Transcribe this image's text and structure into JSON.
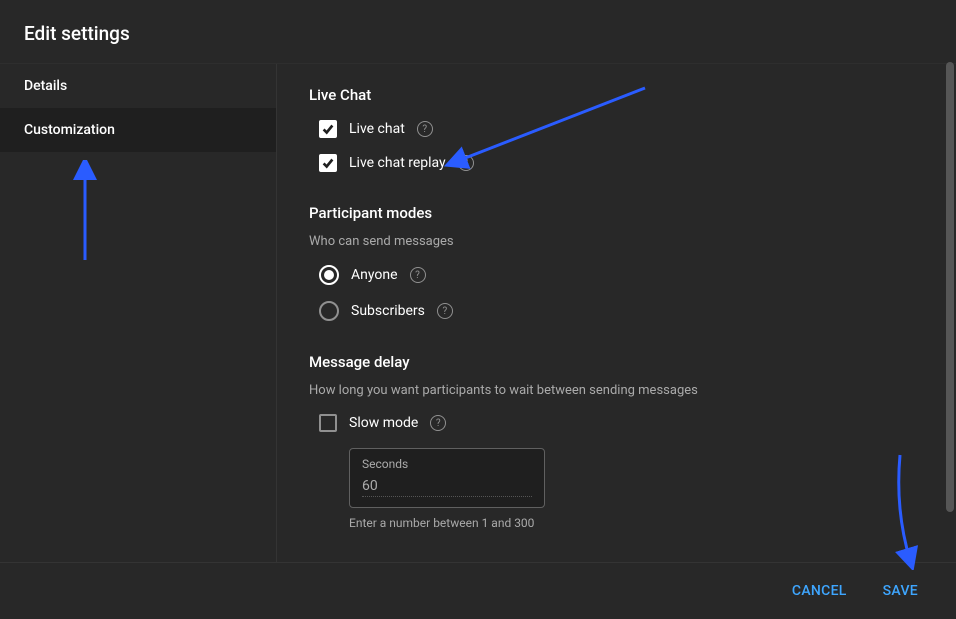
{
  "dialog": {
    "title": "Edit settings"
  },
  "sidebar": {
    "items": [
      {
        "label": "Details"
      },
      {
        "label": "Customization"
      }
    ]
  },
  "sections": {
    "liveChat": {
      "title": "Live Chat",
      "opts": [
        {
          "label": "Live chat"
        },
        {
          "label": "Live chat replay"
        }
      ]
    },
    "participantModes": {
      "title": "Participant modes",
      "sub": "Who can send messages",
      "opts": [
        {
          "label": "Anyone"
        },
        {
          "label": "Subscribers"
        }
      ]
    },
    "messageDelay": {
      "title": "Message delay",
      "sub": "How long you want participants to wait between sending messages",
      "slowMode": {
        "label": "Slow mode"
      },
      "seconds": {
        "floating": "Seconds",
        "value": "60",
        "hint": "Enter a number between 1 and 300"
      }
    }
  },
  "footer": {
    "cancel": "CANCEL",
    "save": "SAVE"
  },
  "help": "?"
}
